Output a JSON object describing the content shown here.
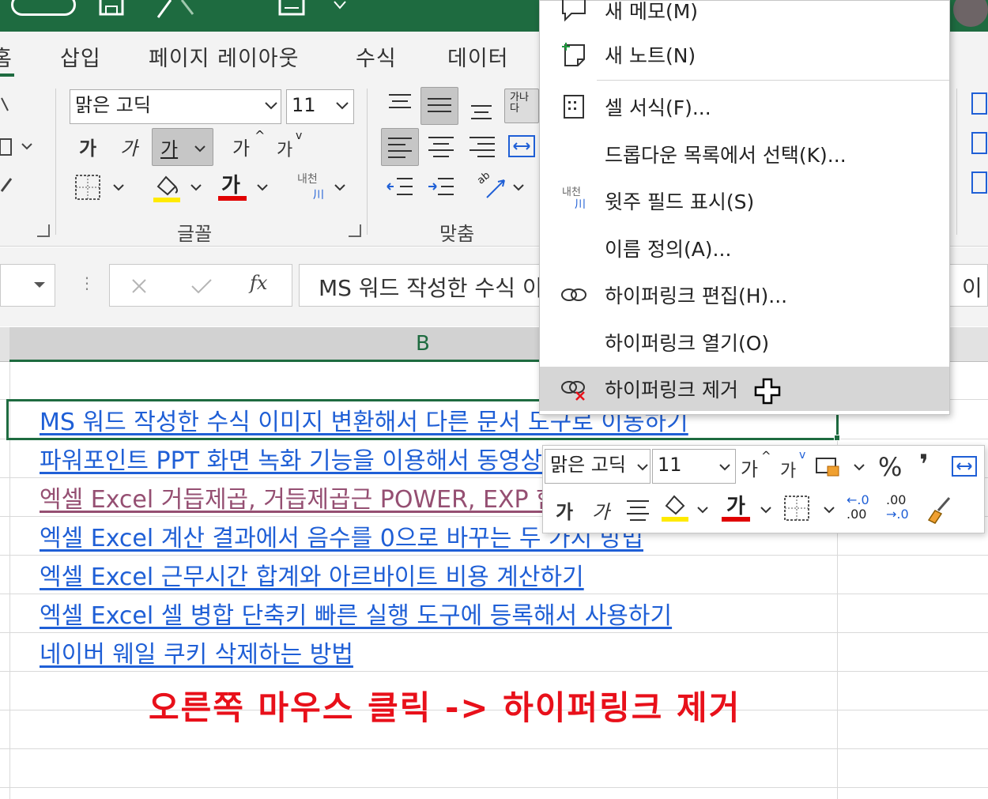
{
  "ribbon": {
    "tabs": [
      "홈",
      "삽입",
      "페이지 레이아웃",
      "수식",
      "데이터"
    ],
    "font_name": "맑은 고딕",
    "font_size": "11",
    "bold": "가",
    "italic": "가",
    "underline": "가",
    "grow_font": "가",
    "shrink_font": "가",
    "font_color": "가",
    "phonetic": "내천",
    "wrap_text": "가나\n다",
    "orientation": "ab",
    "groups": {
      "font": "글꼴",
      "alignment": "맞춤"
    }
  },
  "formula_bar": {
    "fx": "fx",
    "content": "MS 워드 작성한 수식 이미지 변환해서 다른 문서 도구로 이동하기",
    "right_text": "이"
  },
  "grid": {
    "column_b": "B",
    "links": [
      {
        "text": "MS 워드 작성한 수식 이미지 변환해서 다른 문서 도구로 이동하기",
        "visited": false
      },
      {
        "text": "파워포인트 PPT 화면 녹화 기능을 이용해서 동영상 만들기",
        "visited": false
      },
      {
        "text": "엑셀 Excel 거듭제곱, 거듭제곱근 POWER, EXP 함수 사용하기",
        "visited": true
      },
      {
        "text": "엑셀 Excel 계산 결과에서 음수를 0으로 바꾸는 두 가지 방법",
        "visited": false
      },
      {
        "text": "엑셀 Excel 근무시간 합계와 아르바이트 비용 계산하기",
        "visited": false
      },
      {
        "text": "엑셀 Excel 셀 병합 단축키 빠른 실행 도구에 등록해서 사용하기",
        "visited": false
      },
      {
        "text": "네이버 웨일 쿠키 삭제하는 방법",
        "visited": false
      }
    ],
    "caption": "오른쪽 마우스 클릭 -> 하이퍼링크 제거"
  },
  "context_menu": {
    "items": [
      {
        "label": "새 메모(M)",
        "icon": "new-comment-icon"
      },
      {
        "label": "새 노트(N)",
        "icon": "new-note-icon"
      },
      {
        "label": "셀 서식(F)...",
        "icon": "format-cells-icon"
      },
      {
        "label": "드롭다운 목록에서 선택(K)...",
        "icon": ""
      },
      {
        "label": "윗주 필드 표시(S)",
        "icon": "phonetic-icon"
      },
      {
        "label": "이름 정의(A)...",
        "icon": ""
      },
      {
        "label": "하이퍼링크 편집(H)...",
        "icon": "edit-link-icon"
      },
      {
        "label": "하이퍼링크 열기(O)",
        "icon": ""
      },
      {
        "label": "하이퍼링크 제거",
        "icon": "remove-link-icon",
        "highlighted": true
      }
    ]
  },
  "mini_toolbar": {
    "font_name": "맑은 고딕",
    "font_size": "11",
    "grow": "가",
    "shrink": "가",
    "percent": "%",
    "comma": "❜",
    "bold": "가",
    "italic": "가",
    "font_color": "가",
    "inc_decimal_top": "←.0",
    "inc_decimal_bottom": ".00",
    "dec_decimal_top": ".00",
    "dec_decimal_bottom": "→.0"
  },
  "colors": {
    "excel_green": "#1e6b40",
    "link": "#1f5fd6",
    "visited_link": "#954f72",
    "caption": "#e8101a",
    "highlight_yellow": "#ffea00",
    "font_red": "#e00000"
  }
}
